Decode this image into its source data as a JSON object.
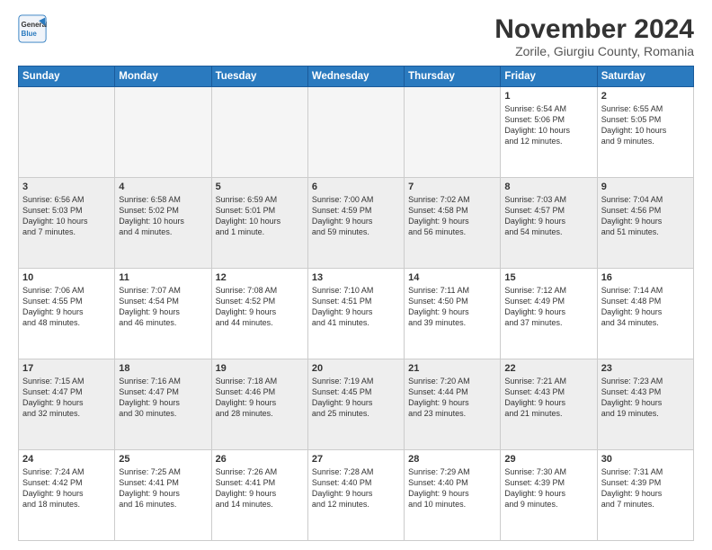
{
  "logo": {
    "general": "General",
    "blue": "Blue"
  },
  "title": "November 2024",
  "location": "Zorile, Giurgiu County, Romania",
  "days_of_week": [
    "Sunday",
    "Monday",
    "Tuesday",
    "Wednesday",
    "Thursday",
    "Friday",
    "Saturday"
  ],
  "weeks": [
    {
      "style": "white",
      "days": [
        {
          "num": "",
          "info": "",
          "empty": true
        },
        {
          "num": "",
          "info": "",
          "empty": true
        },
        {
          "num": "",
          "info": "",
          "empty": true
        },
        {
          "num": "",
          "info": "",
          "empty": true
        },
        {
          "num": "",
          "info": "",
          "empty": true
        },
        {
          "num": "1",
          "info": "Sunrise: 6:54 AM\nSunset: 5:06 PM\nDaylight: 10 hours\nand 12 minutes."
        },
        {
          "num": "2",
          "info": "Sunrise: 6:55 AM\nSunset: 5:05 PM\nDaylight: 10 hours\nand 9 minutes."
        }
      ]
    },
    {
      "style": "gray",
      "days": [
        {
          "num": "3",
          "info": "Sunrise: 6:56 AM\nSunset: 5:03 PM\nDaylight: 10 hours\nand 7 minutes."
        },
        {
          "num": "4",
          "info": "Sunrise: 6:58 AM\nSunset: 5:02 PM\nDaylight: 10 hours\nand 4 minutes."
        },
        {
          "num": "5",
          "info": "Sunrise: 6:59 AM\nSunset: 5:01 PM\nDaylight: 10 hours\nand 1 minute."
        },
        {
          "num": "6",
          "info": "Sunrise: 7:00 AM\nSunset: 4:59 PM\nDaylight: 9 hours\nand 59 minutes."
        },
        {
          "num": "7",
          "info": "Sunrise: 7:02 AM\nSunset: 4:58 PM\nDaylight: 9 hours\nand 56 minutes."
        },
        {
          "num": "8",
          "info": "Sunrise: 7:03 AM\nSunset: 4:57 PM\nDaylight: 9 hours\nand 54 minutes."
        },
        {
          "num": "9",
          "info": "Sunrise: 7:04 AM\nSunset: 4:56 PM\nDaylight: 9 hours\nand 51 minutes."
        }
      ]
    },
    {
      "style": "white",
      "days": [
        {
          "num": "10",
          "info": "Sunrise: 7:06 AM\nSunset: 4:55 PM\nDaylight: 9 hours\nand 48 minutes."
        },
        {
          "num": "11",
          "info": "Sunrise: 7:07 AM\nSunset: 4:54 PM\nDaylight: 9 hours\nand 46 minutes."
        },
        {
          "num": "12",
          "info": "Sunrise: 7:08 AM\nSunset: 4:52 PM\nDaylight: 9 hours\nand 44 minutes."
        },
        {
          "num": "13",
          "info": "Sunrise: 7:10 AM\nSunset: 4:51 PM\nDaylight: 9 hours\nand 41 minutes."
        },
        {
          "num": "14",
          "info": "Sunrise: 7:11 AM\nSunset: 4:50 PM\nDaylight: 9 hours\nand 39 minutes."
        },
        {
          "num": "15",
          "info": "Sunrise: 7:12 AM\nSunset: 4:49 PM\nDaylight: 9 hours\nand 37 minutes."
        },
        {
          "num": "16",
          "info": "Sunrise: 7:14 AM\nSunset: 4:48 PM\nDaylight: 9 hours\nand 34 minutes."
        }
      ]
    },
    {
      "style": "gray",
      "days": [
        {
          "num": "17",
          "info": "Sunrise: 7:15 AM\nSunset: 4:47 PM\nDaylight: 9 hours\nand 32 minutes."
        },
        {
          "num": "18",
          "info": "Sunrise: 7:16 AM\nSunset: 4:47 PM\nDaylight: 9 hours\nand 30 minutes."
        },
        {
          "num": "19",
          "info": "Sunrise: 7:18 AM\nSunset: 4:46 PM\nDaylight: 9 hours\nand 28 minutes."
        },
        {
          "num": "20",
          "info": "Sunrise: 7:19 AM\nSunset: 4:45 PM\nDaylight: 9 hours\nand 25 minutes."
        },
        {
          "num": "21",
          "info": "Sunrise: 7:20 AM\nSunset: 4:44 PM\nDaylight: 9 hours\nand 23 minutes."
        },
        {
          "num": "22",
          "info": "Sunrise: 7:21 AM\nSunset: 4:43 PM\nDaylight: 9 hours\nand 21 minutes."
        },
        {
          "num": "23",
          "info": "Sunrise: 7:23 AM\nSunset: 4:43 PM\nDaylight: 9 hours\nand 19 minutes."
        }
      ]
    },
    {
      "style": "white",
      "days": [
        {
          "num": "24",
          "info": "Sunrise: 7:24 AM\nSunset: 4:42 PM\nDaylight: 9 hours\nand 18 minutes."
        },
        {
          "num": "25",
          "info": "Sunrise: 7:25 AM\nSunset: 4:41 PM\nDaylight: 9 hours\nand 16 minutes."
        },
        {
          "num": "26",
          "info": "Sunrise: 7:26 AM\nSunset: 4:41 PM\nDaylight: 9 hours\nand 14 minutes."
        },
        {
          "num": "27",
          "info": "Sunrise: 7:28 AM\nSunset: 4:40 PM\nDaylight: 9 hours\nand 12 minutes."
        },
        {
          "num": "28",
          "info": "Sunrise: 7:29 AM\nSunset: 4:40 PM\nDaylight: 9 hours\nand 10 minutes."
        },
        {
          "num": "29",
          "info": "Sunrise: 7:30 AM\nSunset: 4:39 PM\nDaylight: 9 hours\nand 9 minutes."
        },
        {
          "num": "30",
          "info": "Sunrise: 7:31 AM\nSunset: 4:39 PM\nDaylight: 9 hours\nand 7 minutes."
        }
      ]
    }
  ]
}
